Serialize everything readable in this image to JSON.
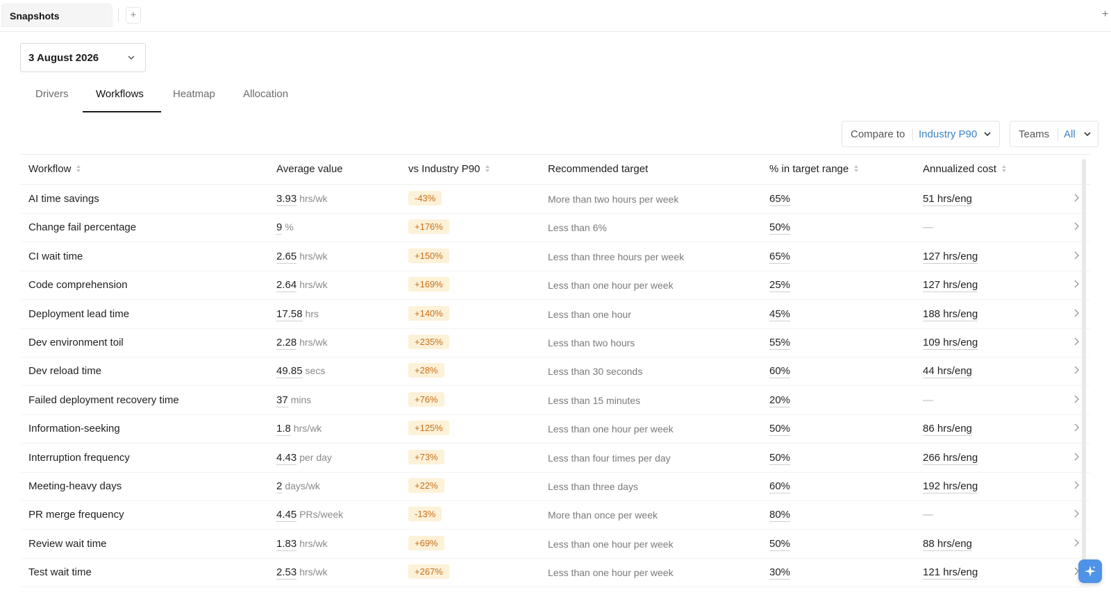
{
  "tabstrip": {
    "tab_label": "Snapshots",
    "add_label": "+",
    "right_add_label": "+"
  },
  "date_picker": {
    "value": "3 August 2026"
  },
  "subtabs": [
    {
      "label": "Drivers",
      "active": false
    },
    {
      "label": "Workflows",
      "active": true
    },
    {
      "label": "Heatmap",
      "active": false
    },
    {
      "label": "Allocation",
      "active": false
    }
  ],
  "filters": {
    "compare_label": "Compare to",
    "compare_value": "Industry P90",
    "teams_label": "Teams",
    "teams_value": "All"
  },
  "table": {
    "headers": {
      "workflow": "Workflow",
      "average": "Average value",
      "delta": "vs Industry P90",
      "target": "Recommended target",
      "pct": "% in target range",
      "cost": "Annualized cost"
    },
    "rows": [
      {
        "name": "AI time savings",
        "value": "3.93",
        "unit": "hrs/wk",
        "delta": "-43%",
        "target": "More than two hours per week",
        "pct": "65%",
        "cost": "51 hrs/eng"
      },
      {
        "name": "Change fail percentage",
        "value": "9",
        "unit": "%",
        "delta": "+176%",
        "target": "Less than 6%",
        "pct": "50%",
        "cost": "—"
      },
      {
        "name": "CI wait time",
        "value": "2.65",
        "unit": "hrs/wk",
        "delta": "+150%",
        "target": "Less than three hours per week",
        "pct": "65%",
        "cost": "127 hrs/eng"
      },
      {
        "name": "Code comprehension",
        "value": "2.64",
        "unit": "hrs/wk",
        "delta": "+169%",
        "target": "Less than one hour per week",
        "pct": "25%",
        "cost": "127 hrs/eng"
      },
      {
        "name": "Deployment lead time",
        "value": "17.58",
        "unit": "hrs",
        "delta": "+140%",
        "target": "Less than one hour",
        "pct": "45%",
        "cost": "188 hrs/eng"
      },
      {
        "name": "Dev environment toil",
        "value": "2.28",
        "unit": "hrs/wk",
        "delta": "+235%",
        "target": "Less than two hours",
        "pct": "55%",
        "cost": "109 hrs/eng"
      },
      {
        "name": "Dev reload time",
        "value": "49.85",
        "unit": "secs",
        "delta": "+28%",
        "target": "Less than 30 seconds",
        "pct": "60%",
        "cost": "44 hrs/eng"
      },
      {
        "name": "Failed deployment recovery time",
        "value": "37",
        "unit": "mins",
        "delta": "+76%",
        "target": "Less than 15 minutes",
        "pct": "20%",
        "cost": "—"
      },
      {
        "name": "Information-seeking",
        "value": "1.8",
        "unit": "hrs/wk",
        "delta": "+125%",
        "target": "Less than one hour per week",
        "pct": "50%",
        "cost": "86 hrs/eng"
      },
      {
        "name": "Interruption frequency",
        "value": "4.43",
        "unit": "per day",
        "delta": "+73%",
        "target": "Less than four times per day",
        "pct": "50%",
        "cost": "266 hrs/eng"
      },
      {
        "name": "Meeting-heavy days",
        "value": "2",
        "unit": "days/wk",
        "delta": "+22%",
        "target": "Less than three days",
        "pct": "60%",
        "cost": "192 hrs/eng"
      },
      {
        "name": "PR merge frequency",
        "value": "4.45",
        "unit": "PRs/week",
        "delta": "-13%",
        "target": "More than once per week",
        "pct": "80%",
        "cost": "—"
      },
      {
        "name": "Review wait time",
        "value": "1.83",
        "unit": "hrs/wk",
        "delta": "+69%",
        "target": "Less than one hour per week",
        "pct": "50%",
        "cost": "88 hrs/eng"
      },
      {
        "name": "Test wait time",
        "value": "2.53",
        "unit": "hrs/wk",
        "delta": "+267%",
        "target": "Less than one hour per week",
        "pct": "30%",
        "cost": "121 hrs/eng"
      }
    ]
  },
  "icons": {
    "chevron": "chevron-down-icon",
    "row_arrow": "chevron-right-icon",
    "sort": "sort-icon",
    "assistant": "sparkle-icon"
  },
  "colors": {
    "accent": "#3b82c4",
    "badge_bg": "#fdf1d8",
    "badge_text": "#c6701a",
    "fab": "#4f93e8"
  }
}
